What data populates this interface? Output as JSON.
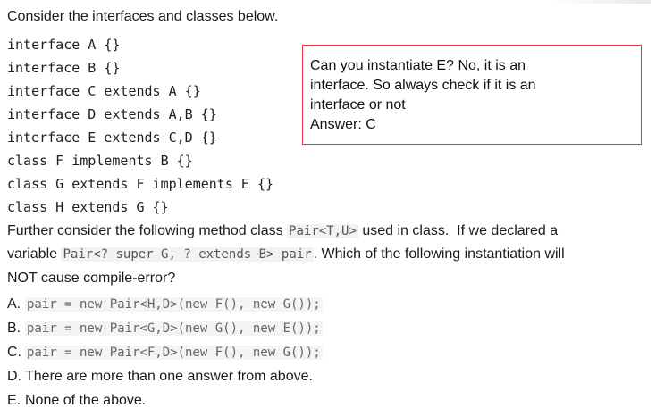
{
  "question": {
    "intro": "Consider the interfaces and classes below.",
    "code_lines": [
      "interface A {}",
      "interface B {}",
      "interface C extends A {}",
      "interface D extends A,B {}",
      "interface E extends C,D {}",
      "class F implements B {}",
      "class G extends F implements E {}",
      "class H extends G {}"
    ],
    "further_1_pre": "Further consider the following method class ",
    "further_1_code": "Pair<T,U>",
    "further_1_post": " used in class.  If we declared a",
    "further_2_pre": "variable ",
    "further_2_code": "Pair<? super G, ? extends B> pair",
    "further_2_post": ". Which of the following instantiation will",
    "further_3": "NOT cause compile-error?"
  },
  "options": [
    {
      "letter": "A.",
      "code": "pair = new Pair<H,D>(new F(), new G());"
    },
    {
      "letter": "B.",
      "code": "pair = new Pair<G,D>(new G(), new E());"
    },
    {
      "letter": "C.",
      "code": "pair = new Pair<F,D>(new F(), new G());"
    },
    {
      "letter": "D.",
      "text": "There are more than one answer from above."
    },
    {
      "letter": "E.",
      "text": "None of the above."
    }
  ],
  "note": {
    "lines": [
      "Can you instantiate E? No, it is an",
      "interface. So always check if it is an",
      "interface or not",
      "Answer: C"
    ],
    "border_color": "#e0353b"
  }
}
